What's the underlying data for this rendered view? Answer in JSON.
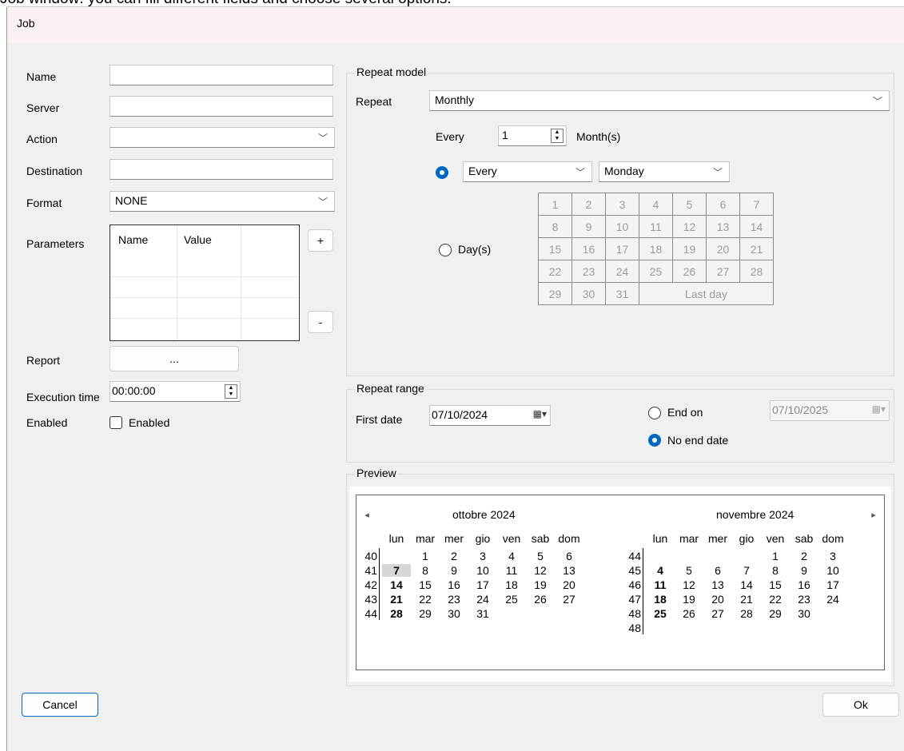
{
  "caption": "Job window: you can fill different fields and choose several options.",
  "window": {
    "title": "Job"
  },
  "left": {
    "name_label": "Name",
    "server_label": "Server",
    "action_label": "Action",
    "destination_label": "Destination",
    "format_label": "Format",
    "format_value": "NONE",
    "parameters_label": "Parameters",
    "params_cols": [
      "Name",
      "Value"
    ],
    "add_param": "+",
    "remove_param": "-",
    "report_label": "Report",
    "report_button": "...",
    "exec_time_label": "Execution time",
    "exec_time_value": "00:00:00",
    "enabled_label": "Enabled",
    "enabled_checkbox_label": "Enabled",
    "enabled_checked": false
  },
  "repeat_model": {
    "group_title": "Repeat model",
    "repeat_label": "Repeat",
    "repeat_value": "Monthly",
    "every_label": "Every",
    "every_value": "1",
    "months_label": "Month(s)",
    "option_every_selected": true,
    "ordinal_value": "Every",
    "weekday_value": "Monday",
    "days_label": "Day(s)",
    "day_rows": [
      [
        "1",
        "2",
        "3",
        "4",
        "5",
        "6",
        "7"
      ],
      [
        "8",
        "9",
        "10",
        "11",
        "12",
        "13",
        "14"
      ],
      [
        "15",
        "16",
        "17",
        "18",
        "19",
        "20",
        "21"
      ],
      [
        "22",
        "23",
        "24",
        "25",
        "26",
        "27",
        "28"
      ],
      [
        "29",
        "30",
        "31"
      ]
    ],
    "last_day_label": "Last day"
  },
  "repeat_range": {
    "group_title": "Repeat range",
    "first_date_label": "First date",
    "first_date_value": "07/10/2024",
    "end_on_label": "End on",
    "end_on_value": "07/10/2025",
    "no_end_label": "No end date",
    "no_end_selected": true
  },
  "preview": {
    "group_title": "Preview",
    "weekday_headers": [
      "lun",
      "mar",
      "mer",
      "gio",
      "ven",
      "sab",
      "dom"
    ],
    "months": [
      {
        "title": "ottobre 2024",
        "weeks": [
          {
            "wk": "40",
            "days": [
              "",
              "1",
              "2",
              "3",
              "4",
              "5",
              "6"
            ]
          },
          {
            "wk": "41",
            "days": [
              "7",
              "8",
              "9",
              "10",
              "11",
              "12",
              "13"
            ]
          },
          {
            "wk": "42",
            "days": [
              "14",
              "15",
              "16",
              "17",
              "18",
              "19",
              "20"
            ]
          },
          {
            "wk": "43",
            "days": [
              "21",
              "22",
              "23",
              "24",
              "25",
              "26",
              "27"
            ]
          },
          {
            "wk": "44",
            "days": [
              "28",
              "29",
              "30",
              "31",
              "",
              "",
              ""
            ]
          }
        ],
        "bold_days": [
          "7",
          "14",
          "21",
          "28"
        ],
        "today": "7"
      },
      {
        "title": "novembre 2024",
        "weeks": [
          {
            "wk": "44",
            "days": [
              "",
              "",
              "",
              "",
              "1",
              "2",
              "3"
            ]
          },
          {
            "wk": "45",
            "days": [
              "4",
              "5",
              "6",
              "7",
              "8",
              "9",
              "10"
            ]
          },
          {
            "wk": "46",
            "days": [
              "11",
              "12",
              "13",
              "14",
              "15",
              "16",
              "17"
            ]
          },
          {
            "wk": "47",
            "days": [
              "18",
              "19",
              "20",
              "21",
              "22",
              "23",
              "24"
            ]
          },
          {
            "wk": "48",
            "days": [
              "25",
              "26",
              "27",
              "28",
              "29",
              "30",
              ""
            ]
          },
          {
            "wk": "48",
            "days": [
              "",
              "",
              "",
              "",
              "",
              "",
              ""
            ]
          }
        ],
        "bold_days": [
          "4",
          "11",
          "18",
          "25"
        ],
        "today": ""
      }
    ],
    "prev_arrow": "◂",
    "next_arrow": "▸"
  },
  "footer": {
    "cancel_label": "Cancel",
    "ok_label": "Ok"
  },
  "colors": {
    "accent": "#0067c0",
    "title_bar": "#fbf1f1",
    "window_bg": "#f0f0f0"
  }
}
